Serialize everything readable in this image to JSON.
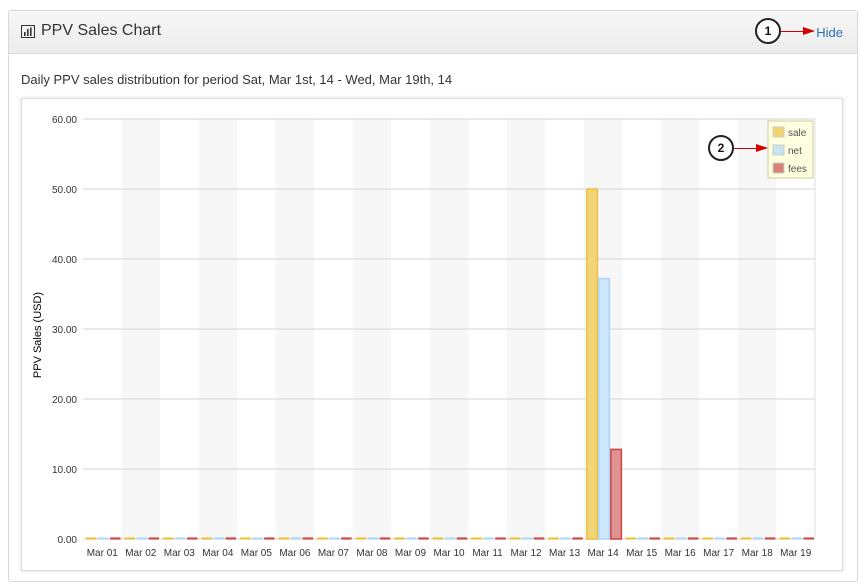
{
  "panel": {
    "title": "PPV Sales Chart",
    "hide_label": "Hide",
    "period_text": "Daily PPV sales distribution for period Sat, Mar 1st, 14 - Wed, Mar 19th, 14"
  },
  "callouts": {
    "one": "1",
    "two": "2"
  },
  "icons": {
    "header": "bar-chart-icon"
  },
  "colors": {
    "sale": "#edc240",
    "net": "#afd8f8",
    "fees": "#cb4b4b"
  },
  "chart_data": {
    "type": "bar",
    "title": "",
    "xlabel": "",
    "ylabel": "PPV Sales (USD)",
    "ylim": [
      0,
      60
    ],
    "yticks": [
      "0.00",
      "10.00",
      "20.00",
      "30.00",
      "40.00",
      "50.00",
      "60.00"
    ],
    "categories": [
      "Mar 01",
      "Mar 02",
      "Mar 03",
      "Mar 04",
      "Mar 05",
      "Mar 06",
      "Mar 07",
      "Mar 08",
      "Mar 09",
      "Mar 10",
      "Mar 11",
      "Mar 12",
      "Mar 13",
      "Mar 14",
      "Mar 15",
      "Mar 16",
      "Mar 17",
      "Mar 18",
      "Mar 19"
    ],
    "series": [
      {
        "name": "sale",
        "values": [
          0,
          0,
          0,
          0,
          0,
          0,
          0,
          0,
          0,
          0,
          0,
          0,
          0,
          50,
          0,
          0,
          0,
          0,
          0
        ]
      },
      {
        "name": "net",
        "values": [
          0,
          0,
          0,
          0,
          0,
          0,
          0,
          0,
          0,
          0,
          0,
          0,
          0,
          37.2,
          0,
          0,
          0,
          0,
          0
        ]
      },
      {
        "name": "fees",
        "values": [
          0,
          0,
          0,
          0,
          0,
          0,
          0,
          0,
          0,
          0,
          0,
          0,
          0,
          12.8,
          0,
          0,
          0,
          0,
          0
        ]
      }
    ],
    "grid": true,
    "legend": "top-right"
  }
}
